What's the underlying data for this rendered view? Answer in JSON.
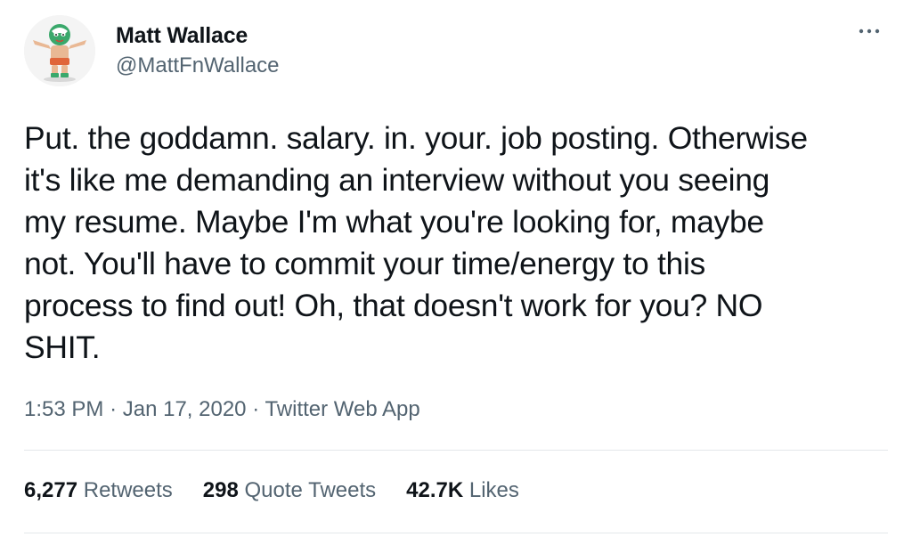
{
  "user": {
    "display_name": "Matt Wallace",
    "handle": "@MattFnWallace",
    "avatar_icon": "luchador-mask-avatar-icon"
  },
  "tweet": {
    "text": "Put. the goddamn. salary. in. your. job posting. Otherwise\nit's like me demanding an interview without you seeing\nmy resume. Maybe I'm what you're looking for, maybe\nnot. You'll have to commit your time/energy to this\nprocess to find out! Oh, that doesn't work for you? NO\nSHIT.",
    "time": "1:53 PM",
    "date": "Jan 17, 2020",
    "source": "Twitter Web App",
    "separator": "·"
  },
  "stats": {
    "retweets_count": "6,277",
    "retweets_label": "Retweets",
    "quotes_count": "298",
    "quotes_label": "Quote Tweets",
    "likes_count": "42.7K",
    "likes_label": "Likes"
  },
  "more_icon": "more-horizontal-icon",
  "colors": {
    "text": "#0f1419",
    "secondary": "#536471",
    "divider": "#e4e8eb"
  }
}
